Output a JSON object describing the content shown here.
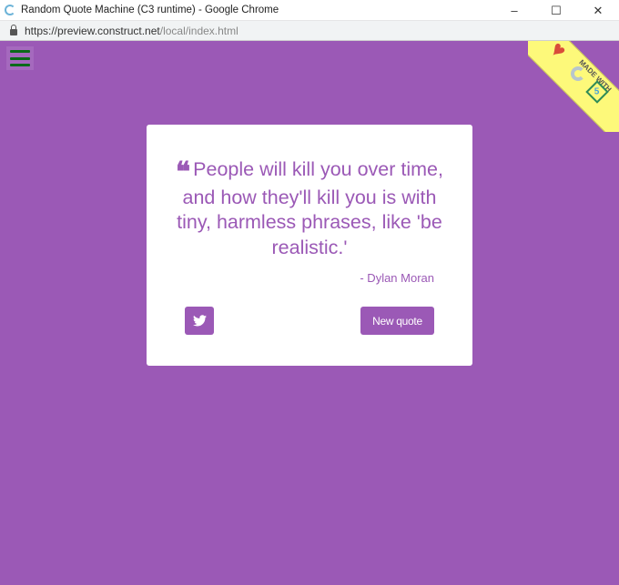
{
  "window": {
    "title": "Random Quote Machine (C3 runtime) - Google Chrome",
    "minimize": "–",
    "maximize": "☐",
    "close": "✕"
  },
  "address": {
    "host": "https://preview.construct.net",
    "path": "/local/index.html"
  },
  "ribbon": {
    "text": "MADE WITH",
    "badge": "5"
  },
  "quote": {
    "mark": "❝",
    "text": "People will kill you over time, and how they'll kill you is with tiny, harmless phrases, like 'be realistic.'",
    "author": "- Dylan Moran"
  },
  "buttons": {
    "new_quote": "New quote"
  },
  "colors": {
    "accent": "#9b59b6",
    "ribbon": "#fdf97a",
    "menu_icon": "#0a6a19"
  }
}
